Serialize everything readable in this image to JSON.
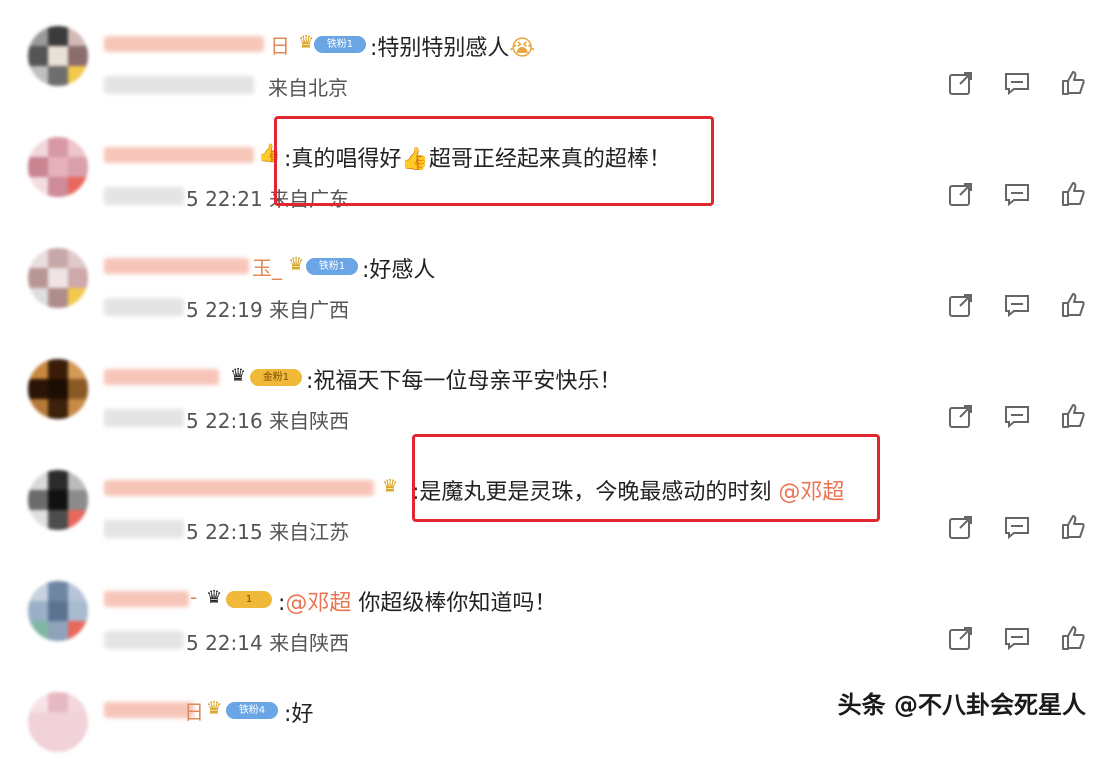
{
  "comments": [
    {
      "name_tail": "日",
      "badge": "铁粉1",
      "badge_style": "blue",
      "text": ":特别特别感人",
      "emoji": "😭",
      "mention": "",
      "text2": "",
      "meta": "来自北京",
      "highlighted": false
    },
    {
      "name_tail": "",
      "badge": "",
      "badge_style": "",
      "text": ":真的唱得好",
      "emoji": "👍",
      "mention": "",
      "text2": "超哥正经起来真的超棒！",
      "meta": "5 22:21 来自广东",
      "highlighted": true
    },
    {
      "name_tail": "玉_",
      "badge": "铁粉1",
      "badge_style": "blue",
      "text": ":好感人",
      "emoji": "",
      "mention": "",
      "text2": "",
      "meta": "5 22:19 来自广西",
      "highlighted": false
    },
    {
      "name_tail": "",
      "badge": "金粉1",
      "badge_style": "gold",
      "text": ":祝福天下每一位母亲平安快乐！",
      "emoji": "",
      "mention": "",
      "text2": "",
      "meta": "5 22:16 来自陕西",
      "highlighted": false
    },
    {
      "name_tail": "",
      "badge": "",
      "badge_style": "",
      "text": ":是魔丸更是灵珠，今晚最感动的时刻",
      "emoji": "",
      "mention": "@邓超",
      "text2": "",
      "meta": "5 22:15 来自江苏",
      "highlighted": true
    },
    {
      "name_tail": "-",
      "badge": "1",
      "badge_style": "gold",
      "text": ":",
      "emoji": "",
      "mention": "@邓超",
      "text2": " 你超级棒你知道吗！",
      "meta": "5 22:14 来自陕西",
      "highlighted": false
    },
    {
      "name_tail": "日",
      "badge": "铁粉4",
      "badge_style": "blue",
      "text": ":好",
      "emoji": "",
      "mention": "",
      "text2": "",
      "meta": "",
      "highlighted": false
    }
  ],
  "watermark": "头条 @不八卦会死星人",
  "icons": {
    "share": "share-icon",
    "comment": "comment-icon",
    "like": "like-icon"
  },
  "colors": {
    "highlight": "#e0262f",
    "mention": "#eb7350",
    "badge_blue": "#6aa5e6",
    "badge_gold": "#f0b93a"
  }
}
